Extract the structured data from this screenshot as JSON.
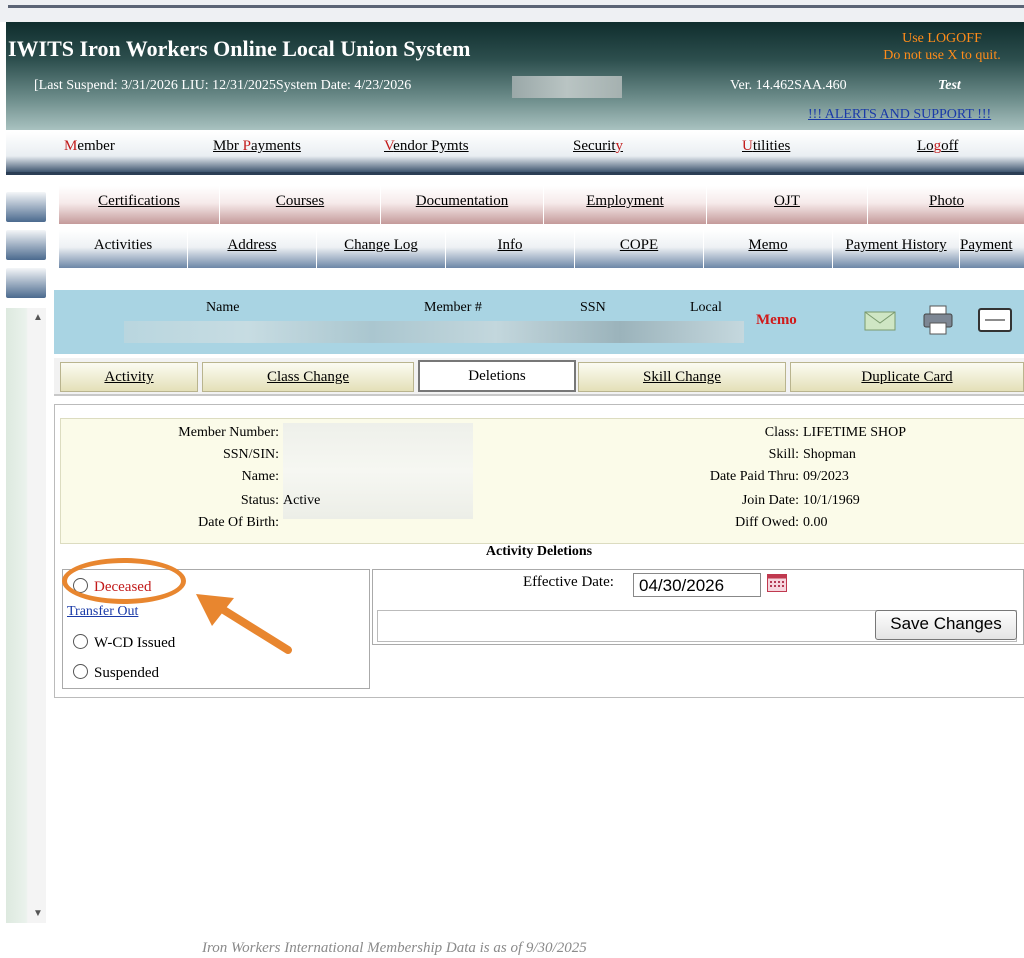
{
  "header": {
    "title": "IWITS Iron Workers Online Local Union System",
    "suspend_line": "[Last Suspend: 3/31/2026 LIU: 12/31/2025System Date: 4/23/2026",
    "version": "Ver. 14.462SAA.460",
    "test_label": "Test",
    "logoff_hint_1": "Use LOGOFF",
    "logoff_hint_2": "Do not use X to quit.",
    "alerts": "!!! ALERTS AND SUPPORT !!!"
  },
  "main_nav": [
    {
      "first": "M",
      "rest": "ember"
    },
    {
      "pre": "Mbr ",
      "first": "P",
      "rest": "ayments"
    },
    {
      "first": "V",
      "rest": "endor Pymts"
    },
    {
      "pre": "Securit",
      "first": "y",
      "rest": ""
    },
    {
      "first": "U",
      "rest": "tilities"
    },
    {
      "pre": "Lo",
      "first": "g",
      "rest": "off"
    }
  ],
  "tabs_row1": [
    "Certifications",
    "Courses",
    "Documentation",
    "Employment",
    "OJT",
    "Photo"
  ],
  "tabs_row2": [
    "Activities",
    "Address",
    "Change Log",
    "Info",
    "COPE",
    "Memo",
    "Payment History",
    "Payment"
  ],
  "member_bar": {
    "name_label": "Name",
    "member_label": "Member #",
    "ssn_label": "SSN",
    "local_label": "Local",
    "memo": "Memo"
  },
  "action_tabs": [
    "Activity",
    "Class Change",
    "Deletions",
    "Skill Change",
    "Duplicate Card"
  ],
  "info": {
    "member_number_label": "Member Number:",
    "ssn_label": "SSN/SIN:",
    "name_label": "Name:",
    "status_label": "Status:",
    "status_value": "Active",
    "dob_label": "Date Of Birth:",
    "class_label": "Class:",
    "class_value": "LIFETIME SHOP",
    "skill_label": "Skill:",
    "skill_value": "Shopman",
    "paid_label": "Date Paid Thru:",
    "paid_value": "09/2023",
    "join_label": "Join Date:",
    "join_value": "10/1/1969",
    "diff_label": "Diff Owed:",
    "diff_value": "0.00"
  },
  "deletions": {
    "title": "Activity Deletions",
    "deceased": "Deceased",
    "transfer_out": "Transfer Out",
    "wcd": "W-CD Issued",
    "suspended": "Suspended",
    "effective_label": "Effective Date:",
    "effective_value": "04/30/2026",
    "save_label": "Save Changes"
  },
  "footer": "Iron Workers International Membership Data is as of 9/30/2025",
  "colors": {
    "accent_orange": "#e8862f",
    "memo_red": "#d01a1a",
    "link_blue": "#1a3aa8"
  }
}
